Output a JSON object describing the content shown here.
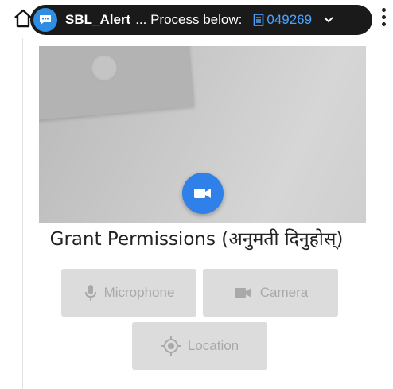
{
  "notification": {
    "title": "SBL_Alert",
    "message": "... Process below:",
    "link_text": "049269",
    "app_icon": "chat-bubble-icon",
    "colors": {
      "background": "#1a1a1a",
      "link": "#4da3ff",
      "avatar": "#2f8de4"
    }
  },
  "camera": {
    "switch_icon": "videocam-icon",
    "fab_color": "#2f80e8"
  },
  "permissions": {
    "heading": "Grant Permissions (अनुमती दिनुहोस्)",
    "buttons": [
      {
        "label": "Microphone",
        "icon": "microphone-icon"
      },
      {
        "label": "Camera",
        "icon": "videocam-icon"
      },
      {
        "label": "Location",
        "icon": "location-target-icon"
      }
    ],
    "button_color": "#dcdcdc",
    "button_text_color": "#a9a9a9"
  }
}
